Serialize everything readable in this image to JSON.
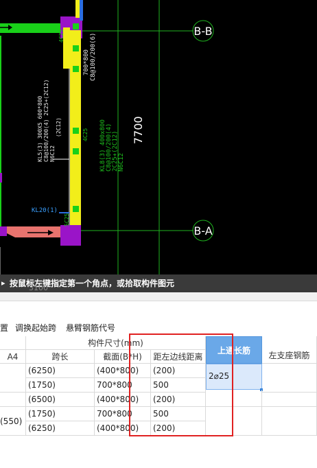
{
  "cad": {
    "axis_top": "B-B",
    "axis_bottom": "B-A",
    "dimension": "7700",
    "bottom_label": "3100",
    "left_beam_label": "KL20(1)",
    "top_col_label": "4C25",
    "mid_col_label": "4C25",
    "bot_col_label": "5C25",
    "left_beam_annot_1": "KL5(3) 300X5 600*800",
    "left_beam_annot_2": "C8@100/200(4) 2C25+(2C12)",
    "left_beam_annot_3": "N6C12",
    "left_beam_annot_4": "(2C12)",
    "beam_annot_top_1": "700*800",
    "beam_annot_top_2": "C8@100/200(6)",
    "beam_annot_right_1": "KL8(3) 400x800",
    "beam_annot_right_2": "C8@100/200(4)",
    "beam_annot_right_3": "2C25+(2C12)",
    "beam_annot_right_4": "N6C12",
    "colors": {
      "yellow": "#f2ee1a",
      "magenta": "#9a14c8",
      "green": "#19d019",
      "line": "#1fb51f",
      "salmon": "#e8736e"
    }
  },
  "status": {
    "message": "按鼠标左键指定第一个角点，或拾取构件图元",
    "ghost": "3100"
  },
  "toolbar": {
    "items": [
      "置",
      "调换起始跨",
      "悬臂钢筋代号"
    ]
  },
  "grid": {
    "group_header": "构件尺寸(mm)",
    "col_a4": "A4",
    "col_span": "跨长",
    "col_section": "截面(B*H)",
    "col_dist": "距左边线距离",
    "col_top": "上通长筋",
    "col_left": "左支座钢筋",
    "rows": [
      {
        "a4": "",
        "span": "(6250)",
        "section": "(400*800)",
        "dist": "(200)"
      },
      {
        "a4": "",
        "span": "(1750)",
        "section": "700*800",
        "dist": "500"
      },
      {
        "a4": "",
        "span": "(6500)",
        "section": "(400*800)",
        "dist": "(200)"
      },
      {
        "a4": "(550)",
        "span": "(1750)",
        "section": "700*800",
        "dist": "500"
      },
      {
        "a4": "",
        "span": "(6250)",
        "section": "(400*800)",
        "dist": "(200)"
      }
    ],
    "top_rebar_value": "2⌀25"
  }
}
